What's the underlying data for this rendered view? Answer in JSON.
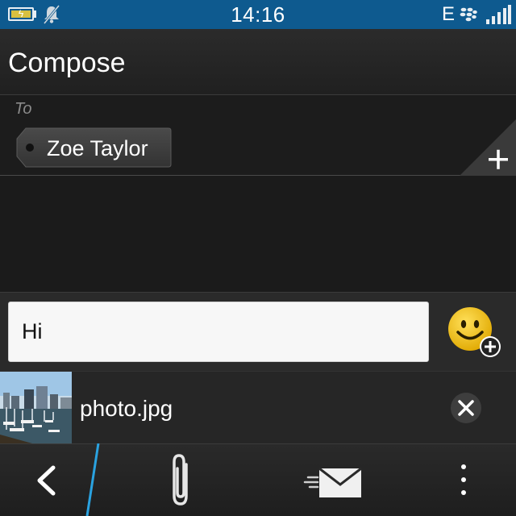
{
  "status_bar": {
    "time": "14:16",
    "network_type": "E",
    "icons": [
      "battery-charging-icon",
      "silent-bell-icon",
      "blackberry-logo-icon",
      "signal-strength-icon"
    ]
  },
  "header": {
    "title": "Compose"
  },
  "recipients": {
    "label": "To",
    "chips": [
      {
        "name": "Zoe Taylor"
      }
    ],
    "add_icon": "plus-icon"
  },
  "message": {
    "value": "Hi",
    "emoji_icon": "smiley-add-icon"
  },
  "attachment": {
    "file_name": "photo.jpg",
    "thumbnail": "harbor-photo",
    "remove_icon": "close-icon"
  },
  "action_bar": {
    "items": [
      "back-icon",
      "paperclip-icon",
      "send-icon",
      "overflow-menu-icon"
    ]
  },
  "colors": {
    "status_bar": "#0e5a8f",
    "accent": "#2aa2e0",
    "emoji": "#f2c21b",
    "background": "#1b1b1b"
  }
}
